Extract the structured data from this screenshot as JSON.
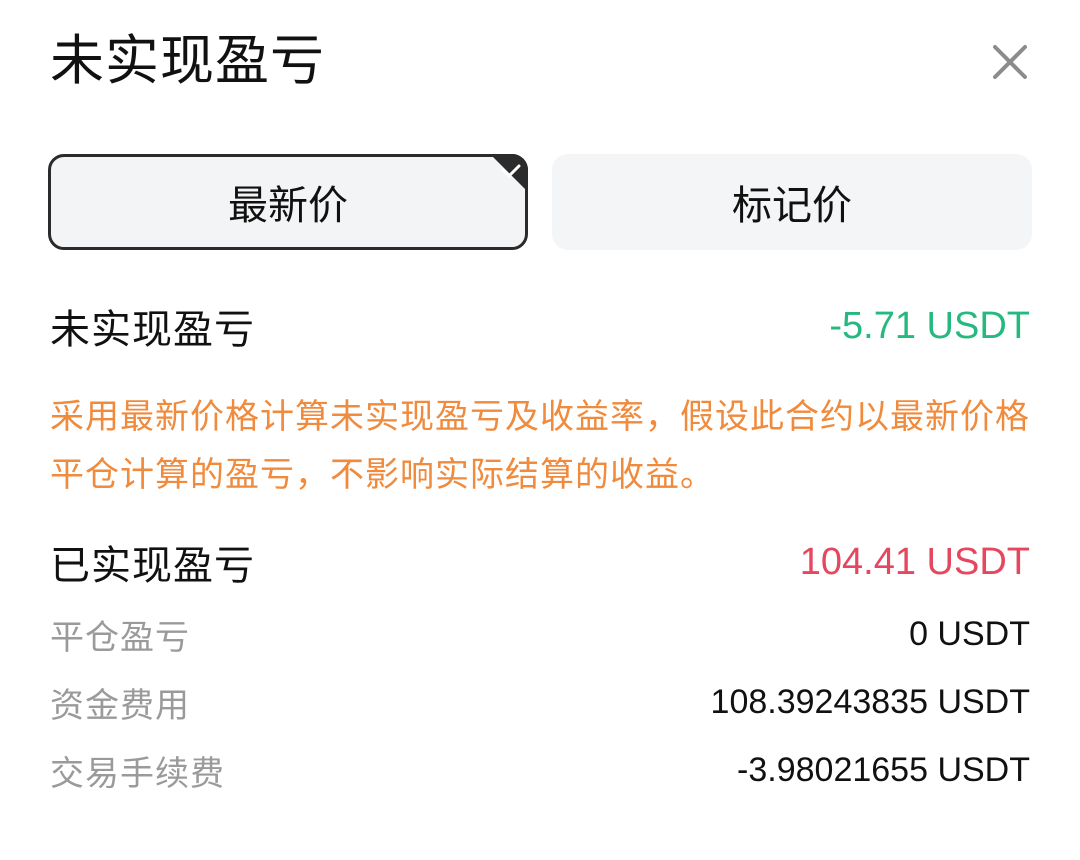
{
  "header": {
    "title": "未实现盈亏",
    "close_icon": "close-icon"
  },
  "tabs": [
    {
      "label": "最新价",
      "selected": true
    },
    {
      "label": "标记价",
      "selected": false
    }
  ],
  "unrealized": {
    "label": "未实现盈亏",
    "value": "-5.71 USDT",
    "value_color": "#26b97f"
  },
  "note": "采用最新价格计算未实现盈亏及收益率，假设此合约以最新价格平仓计算的盈亏，不影响实际结算的收益。",
  "realized": {
    "label": "已实现盈亏",
    "value": "104.41 USDT",
    "value_color": "#e5475f",
    "items": [
      {
        "label": "平仓盈亏",
        "value": "0 USDT"
      },
      {
        "label": "资金费用",
        "value": "108.39243835 USDT"
      },
      {
        "label": "交易手续费",
        "value": "-3.98021655 USDT"
      }
    ]
  },
  "colors": {
    "note": "#f08a3c",
    "tab_bg": "#f4f5f6",
    "tab_border_selected": "#2b2b2b",
    "muted_label": "#9a9a9a"
  }
}
